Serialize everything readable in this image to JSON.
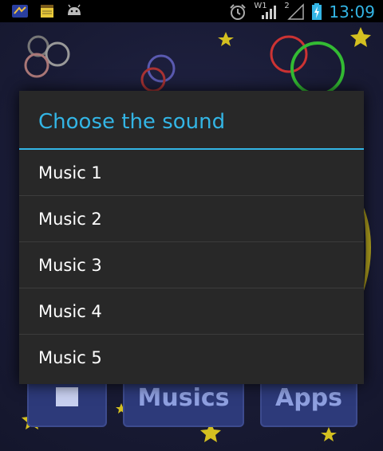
{
  "status_bar": {
    "notifications": [
      "game-icon",
      "notes-icon",
      "android-icon"
    ],
    "icons": [
      "alarm-icon",
      "wifi-signal-icon",
      "mobile-signal-icon",
      "battery-charging-icon"
    ],
    "wifi_label": "W1",
    "network_label": "2",
    "time": "13:09",
    "accent": "#33b5e5"
  },
  "background_app": {
    "buttons": [
      {
        "label": ""
      },
      {
        "label": "Musics"
      },
      {
        "label": "Apps"
      }
    ]
  },
  "dialog": {
    "title": "Choose the sound",
    "options": [
      {
        "label": "Music 1"
      },
      {
        "label": "Music 2"
      },
      {
        "label": "Music 3"
      },
      {
        "label": "Music 4"
      },
      {
        "label": "Music 5"
      }
    ],
    "accent": "#33b5e5",
    "background": "#282828"
  }
}
